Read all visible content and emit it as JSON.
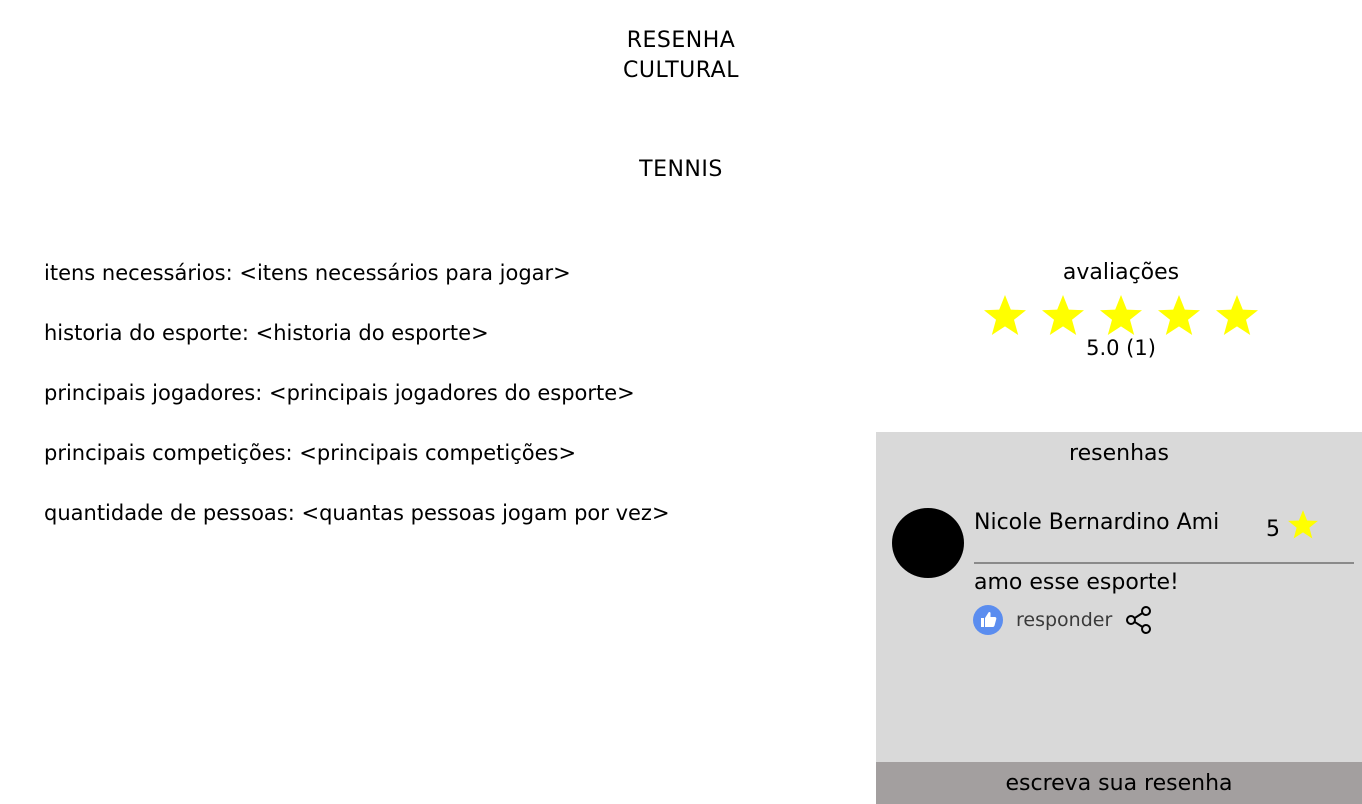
{
  "header": {
    "title_line1": "RESENHA",
    "title_line2": "CULTURAL"
  },
  "sport": {
    "title": "TENNIS"
  },
  "info": {
    "items": [
      "itens necessários: <itens necessários para jogar>",
      "historia do esporte: <historia do esporte>",
      "principais jogadores: <principais jogadores do esporte>",
      "principais competições: <principais competições>",
      "quantidade de pessoas: <quantas pessoas jogam por vez>"
    ]
  },
  "ratings": {
    "title": "avaliações",
    "stars_filled": 5,
    "stars_total": 5,
    "summary": "5.0 (1)",
    "star_color": "#ffff00"
  },
  "reviews": {
    "title": "resenhas",
    "panel_color": "#d9d9d9",
    "items": [
      {
        "author": "Nicole Bernardino Ami",
        "score": "5",
        "text": "amo esse esporte!",
        "reply_label": "responder",
        "icons": [
          "thumbs-up-icon",
          "share-icon"
        ]
      }
    ],
    "write_label": "escreva sua resenha",
    "write_button_color": "#a39f9f"
  }
}
